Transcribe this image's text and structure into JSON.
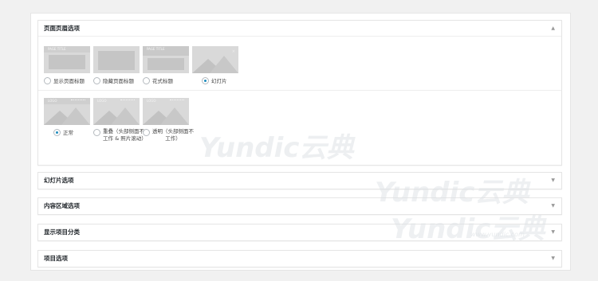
{
  "header_section": {
    "title": "页面页眉选项",
    "toggle": "▲",
    "title_options": [
      {
        "label": "显示页面标题",
        "thumb_text": "PAGE TITLE",
        "checked": false
      },
      {
        "label": "隐藏页面标题",
        "thumb_text": "",
        "checked": false
      },
      {
        "label": "花式标题",
        "thumb_text": "PAGE TITLE",
        "checked": false
      },
      {
        "label": "幻灯片",
        "thumb_text": "",
        "checked": true
      }
    ],
    "layout_options": [
      {
        "label": "正常",
        "thumb_text": "LOGO",
        "checked": true
      },
      {
        "label": "重叠（头部侧面不工作 & 照片滚动）",
        "thumb_text": "LOGO",
        "checked": false
      },
      {
        "label": "透明（头部侧面不工作）",
        "thumb_text": "LOGO",
        "checked": false
      }
    ]
  },
  "sections": [
    {
      "title": "幻灯片选项",
      "toggle": "▼"
    },
    {
      "title": "内容区域选项",
      "toggle": "▼"
    },
    {
      "title": "显示项目分类",
      "toggle": "▼"
    },
    {
      "title": "项目选项",
      "toggle": "▼"
    }
  ],
  "watermark": {
    "text": "Yundic云典",
    "url": "www.yundic.com"
  }
}
